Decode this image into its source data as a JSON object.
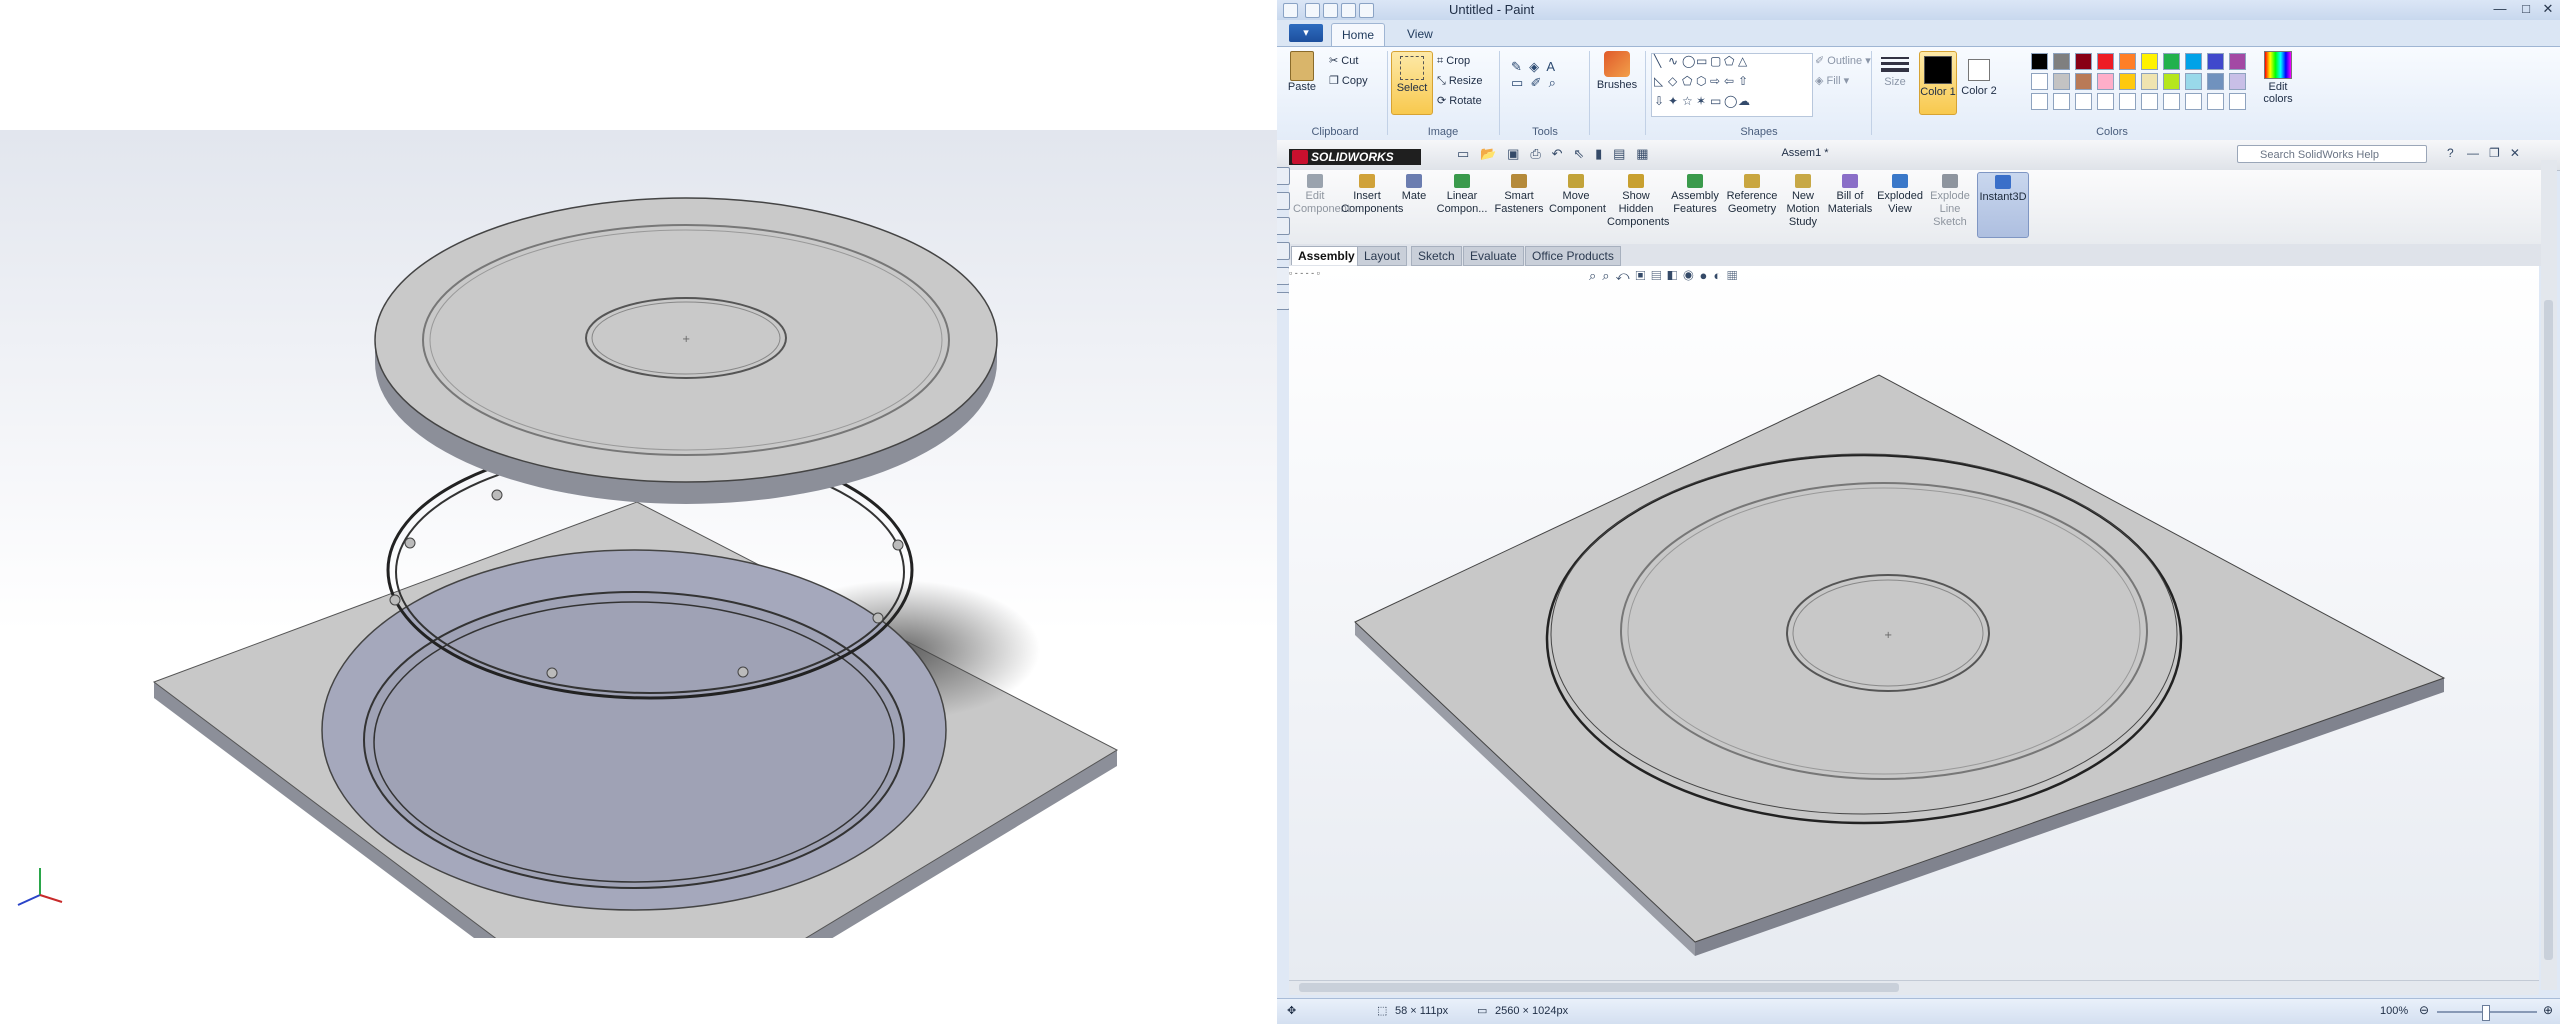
{
  "window": {
    "title": "Untitled - Paint",
    "controls": {
      "minimize": "—",
      "maximize": "□",
      "close": "✕"
    }
  },
  "paint": {
    "menu_button": "▾",
    "tabs": [
      {
        "label": "Home"
      },
      {
        "label": "View"
      }
    ],
    "clipboard": {
      "paste": "Paste",
      "cut": "Cut",
      "copy": "Copy",
      "group": "Clipboard"
    },
    "image": {
      "select": "Select",
      "crop": "Crop",
      "resize": "Resize",
      "rotate": "Rotate",
      "group": "Image"
    },
    "tools": {
      "group": "Tools"
    },
    "brushes": {
      "label": "Brushes"
    },
    "shapes": {
      "outline": "Outline",
      "fill": "Fill",
      "group": "Shapes"
    },
    "size": {
      "label": "Size"
    },
    "color1": {
      "label": "Color 1"
    },
    "color2": {
      "label": "Color 2"
    },
    "colors": {
      "group": "Colors",
      "edit": "Edit colors"
    },
    "palette_row1": [
      "#000000",
      "#7f7f7f",
      "#880015",
      "#ed1c24",
      "#ff7f27",
      "#fff200",
      "#22b14c",
      "#00a2e8",
      "#3f48cc",
      "#a349a4"
    ],
    "palette_row2": [
      "#ffffff",
      "#c3c3c3",
      "#b97a57",
      "#ffaec9",
      "#ffc90e",
      "#efe4b0",
      "#b5e61d",
      "#99d9ea",
      "#7092be",
      "#c8bfe7"
    ],
    "status": {
      "selection_size": "58 × 111px",
      "image_size": "2560 × 1024px",
      "zoom": "100%"
    }
  },
  "solidworks": {
    "logo": "SOLIDWORKS",
    "doc_title": "Assem1 *",
    "search_placeholder": "Search SolidWorks Help",
    "commands": [
      {
        "label": "Edit Component"
      },
      {
        "label": "Insert Components"
      },
      {
        "label": "Mate"
      },
      {
        "label": "Linear Compon..."
      },
      {
        "label": "Smart Fasteners"
      },
      {
        "label": "Move Component"
      },
      {
        "label": "Show Hidden Components"
      },
      {
        "label": "Assembly Features"
      },
      {
        "label": "Reference Geometry"
      },
      {
        "label": "New Motion Study"
      },
      {
        "label": "Bill of Materials"
      },
      {
        "label": "Exploded View"
      },
      {
        "label": "Explode Line Sketch"
      },
      {
        "label": "Instant3D"
      }
    ],
    "tabs": [
      "Assembly",
      "Layout",
      "Sketch",
      "Evaluate",
      "Office Products"
    ]
  },
  "colors": {
    "plate_top": "#c8c8c8",
    "plate_side": "#8c8f99",
    "recess": "#a5a8bc"
  }
}
